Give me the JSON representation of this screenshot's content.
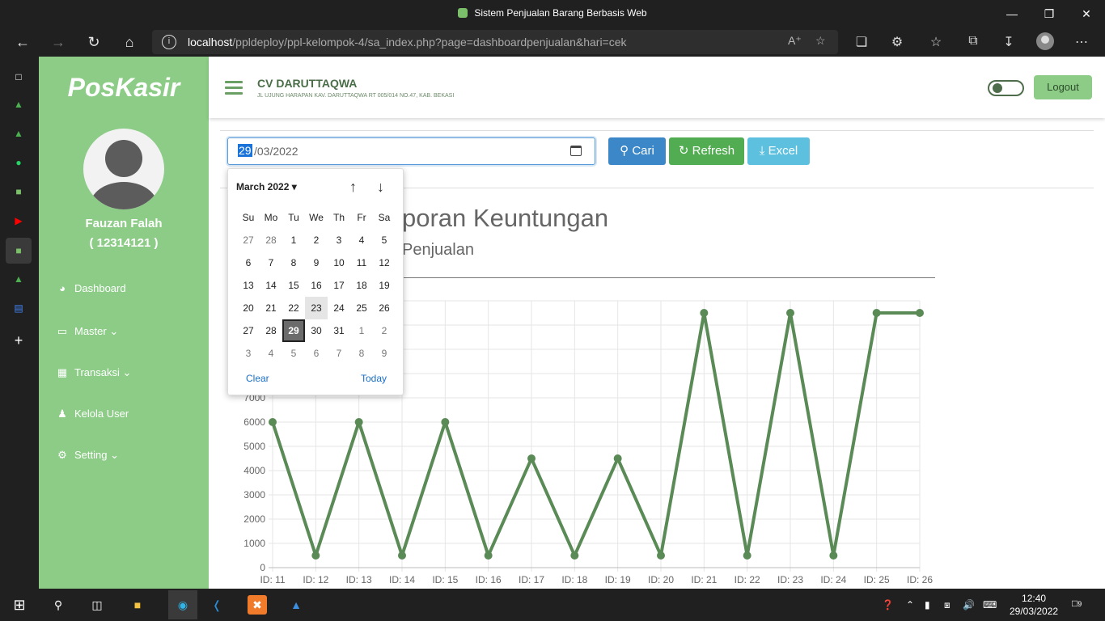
{
  "browser": {
    "title": "Sistem Penjualan Barang Berbasis Web",
    "url_host": "localhost",
    "url_path": "/ppldeploy/ppl-kelompok-4/sa_index.php?page=dashboardpenjualan&hari=cek"
  },
  "sidebar": {
    "brand": "PosKasir",
    "user_name": "Fauzan Falah",
    "user_id": "( 12314121 )",
    "items": [
      {
        "label": "Dashboard"
      },
      {
        "label": "Master"
      },
      {
        "label": "Transaksi"
      },
      {
        "label": "Kelola User"
      },
      {
        "label": "Setting"
      }
    ]
  },
  "topbar": {
    "company": "CV DARUTTAQWA",
    "address": "JL UJUNG HARAPAN KAV. DARUTTAQWA RT 005/014 NO.47, KAB. BEKASI",
    "logout": "Logout"
  },
  "filter": {
    "date_day": "29",
    "date_rest": "/03/2022",
    "cari": "Cari",
    "refresh": "Refresh",
    "excel": "Excel"
  },
  "page": {
    "heading": "poran Keuntungan",
    "subheading": "Penjualan"
  },
  "datepicker": {
    "month": "March 2022",
    "dow": [
      "Su",
      "Mo",
      "Tu",
      "We",
      "Th",
      "Fr",
      "Sa"
    ],
    "weeks": [
      [
        "27",
        "28",
        "1",
        "2",
        "3",
        "4",
        "5"
      ],
      [
        "6",
        "7",
        "8",
        "9",
        "10",
        "11",
        "12"
      ],
      [
        "13",
        "14",
        "15",
        "16",
        "17",
        "18",
        "19"
      ],
      [
        "20",
        "21",
        "22",
        "23",
        "24",
        "25",
        "26"
      ],
      [
        "27",
        "28",
        "29",
        "30",
        "31",
        "1",
        "2"
      ],
      [
        "3",
        "4",
        "5",
        "6",
        "7",
        "8",
        "9"
      ]
    ],
    "clear": "Clear",
    "today": "Today"
  },
  "chart_data": {
    "type": "line",
    "x": [
      "ID: 11",
      "ID: 12",
      "ID: 13",
      "ID: 14",
      "ID: 15",
      "ID: 16",
      "ID: 17",
      "ID: 18",
      "ID: 19",
      "ID: 20",
      "ID: 21",
      "ID: 22",
      "ID: 23",
      "ID: 24",
      "ID: 25",
      "ID: 26"
    ],
    "series": [
      {
        "values": [
          6000,
          500,
          6000,
          500,
          6000,
          500,
          4500,
          500,
          4500,
          500,
          10500,
          500,
          10500,
          500,
          10500,
          10500
        ]
      }
    ],
    "yticks": [
      0,
      1000,
      2000,
      3000,
      4000,
      5000,
      6000,
      7000
    ],
    "ylim": [
      0,
      11000
    ],
    "color": "#5a8a55",
    "grid": true
  },
  "taskbar": {
    "time": "12:40",
    "date": "29/03/2022",
    "notif": "9"
  }
}
